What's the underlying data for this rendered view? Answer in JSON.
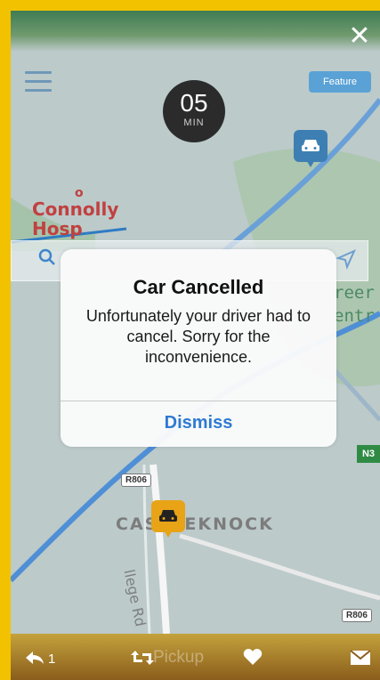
{
  "timer": {
    "value": "05",
    "unit": "MIN"
  },
  "header": {
    "feature_button": "Feature"
  },
  "map": {
    "poi_name": "Connolly",
    "poi_name_2": "Hosp",
    "green_label_1": "reer",
    "green_label_2": "entr",
    "place_label": "CASTLEKNOCK",
    "road_label_1": "R806",
    "road_label_2": "R806",
    "road_label_3": "N3",
    "road_name": "llege Rd"
  },
  "modal": {
    "title": "Car Cancelled",
    "message": "Unfortunately your driver had to cancel. Sorry for the inconvenience.",
    "dismiss_label": "Dismiss"
  },
  "bottom_bar": {
    "reply_count": "1",
    "background_text": "Pickup"
  },
  "colors": {
    "frame": "#f2c200",
    "dismiss": "#2e7ad2",
    "pickup_pin": "#e8a317",
    "driver_pin": "#3e7fb3"
  },
  "icons": [
    "close-icon",
    "hamburger-icon",
    "search-icon",
    "locate-arrow-icon",
    "car-icon",
    "reply-icon",
    "retweet-icon",
    "heart-icon",
    "message-icon"
  ]
}
